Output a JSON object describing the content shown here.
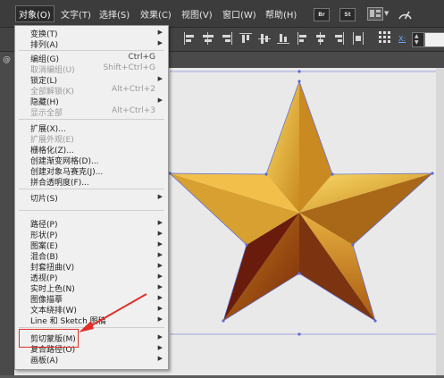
{
  "menubar": {
    "items": [
      {
        "label": "对象(O)",
        "active": true
      },
      {
        "label": "文字(T)"
      },
      {
        "label": "选择(S)"
      },
      {
        "label": "效果(C)"
      },
      {
        "label": "视图(V)"
      },
      {
        "label": "窗口(W)"
      },
      {
        "label": "帮助(H)"
      }
    ],
    "br_button": "Br",
    "st_button": "St"
  },
  "toolbar": {
    "x_label": "X:"
  },
  "leftstrip": {
    "label": "@"
  },
  "object_menu": [
    {
      "label": "变换(T)",
      "submenu": true
    },
    {
      "label": "排列(A)",
      "submenu": true
    },
    {
      "label": "编组(G)",
      "shortcut": "Ctrl+G"
    },
    {
      "label": "取消编组(U)",
      "shortcut": "Shift+Ctrl+G",
      "disabled": true
    },
    {
      "label": "锁定(L)",
      "submenu": true
    },
    {
      "label": "全部解锁(K)",
      "shortcut": "Alt+Ctrl+2",
      "disabled": true
    },
    {
      "label": "隐藏(H)",
      "submenu": true
    },
    {
      "label": "显示全部",
      "shortcut": "Alt+Ctrl+3",
      "disabled": true
    },
    {
      "label": "扩展(X)..."
    },
    {
      "label": "扩展外观(E)",
      "disabled": true
    },
    {
      "label": "栅格化(Z)..."
    },
    {
      "label": "创建渐变网格(D)..."
    },
    {
      "label": "创建对象马赛克(J)..."
    },
    {
      "label": "拼合透明度(F)..."
    },
    {
      "label": "切片(S)",
      "submenu": true
    },
    {
      "label": "路径(P)",
      "submenu": true
    },
    {
      "label": "形状(P)",
      "submenu": true
    },
    {
      "label": "图案(E)",
      "submenu": true
    },
    {
      "label": "混合(B)",
      "submenu": true
    },
    {
      "label": "封套扭曲(V)",
      "submenu": true
    },
    {
      "label": "透视(P)",
      "submenu": true
    },
    {
      "label": "实时上色(N)",
      "submenu": true
    },
    {
      "label": "图像描摹",
      "submenu": true
    },
    {
      "label": "文本绕排(W)",
      "submenu": true
    },
    {
      "label": "Line 和 Sketch 图稿",
      "submenu": true
    },
    {
      "label": "剪切蒙版(M)",
      "submenu": true,
      "highlighted": true
    },
    {
      "label": "复合路径(O)",
      "submenu": true
    },
    {
      "label": "画板(A)",
      "submenu": true
    }
  ],
  "colors": {
    "highlight": "#e0302a",
    "star_light": "#f5c64a",
    "star_dark": "#8a3a10"
  }
}
